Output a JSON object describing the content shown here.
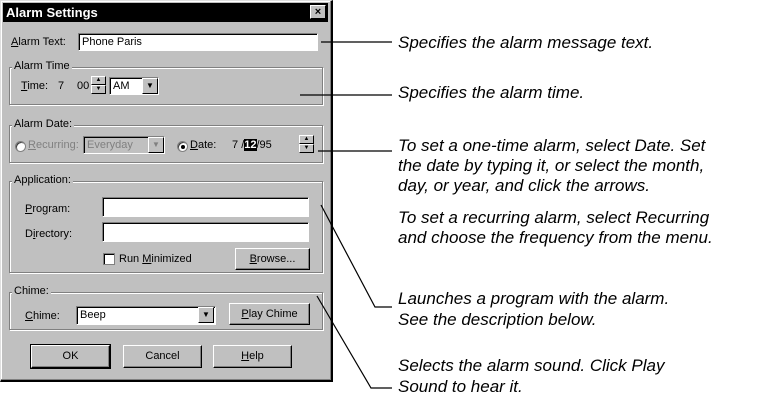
{
  "dialog": {
    "title": "Alarm Settings",
    "close_glyph": "×",
    "alarm_text": {
      "label_u": "A",
      "label_rest": "larm Text:",
      "value": "Phone Paris"
    },
    "alarm_time": {
      "group": "Alarm Time",
      "label_u": "T",
      "label_rest": "ime:",
      "hour": "7",
      "minute": "00",
      "ampm": "AM"
    },
    "alarm_date": {
      "group": "Alarm Date:",
      "recurring_u": "R",
      "recurring_rest": "ecurring:",
      "recurring_value": "Everyday",
      "date_u": "D",
      "date_rest": "ate:",
      "month": "7",
      "sep1": "/",
      "day": "12",
      "sep2": "/95"
    },
    "application": {
      "group": "Application:",
      "program_u": "P",
      "program_rest": "rogram:",
      "directory_pre": "D",
      "directory_u": "i",
      "directory_rest": "rectory:",
      "run_min_pre": "Run ",
      "run_min_u": "M",
      "run_min_rest": "inimized",
      "browse_u": "B",
      "browse_rest": "rowse..."
    },
    "chime": {
      "group": "Chime:",
      "label_u": "C",
      "label_rest": "hime:",
      "value": "Beep",
      "play_u": "P",
      "play_rest": "lay Chime"
    },
    "buttons": {
      "ok": "OK",
      "cancel": "Cancel",
      "help_u": "H",
      "help_rest": "elp"
    }
  },
  "annotations": {
    "alarm_text": "Specifies the alarm message text.",
    "alarm_time": "Specifies the alarm time.",
    "date_line1": "To set a one-time alarm, select Date. Set",
    "date_line2": "the date by typing it, or select the month,",
    "date_line3": "day, or year, and click the arrows.",
    "recur_line1": "To set a recurring alarm, select Recurring",
    "recur_line2": "and choose the frequency from the menu.",
    "app_line1": "Launches a program with the alarm.",
    "app_line2": "See the description below.",
    "chime_line1": "Selects the alarm sound. Click Play",
    "chime_line2": "Sound to hear it."
  },
  "icons": [
    "close-icon",
    "spin-up-icon",
    "spin-down-icon",
    "dropdown-arrow-icon",
    "radio-icon",
    "checkbox-icon"
  ]
}
